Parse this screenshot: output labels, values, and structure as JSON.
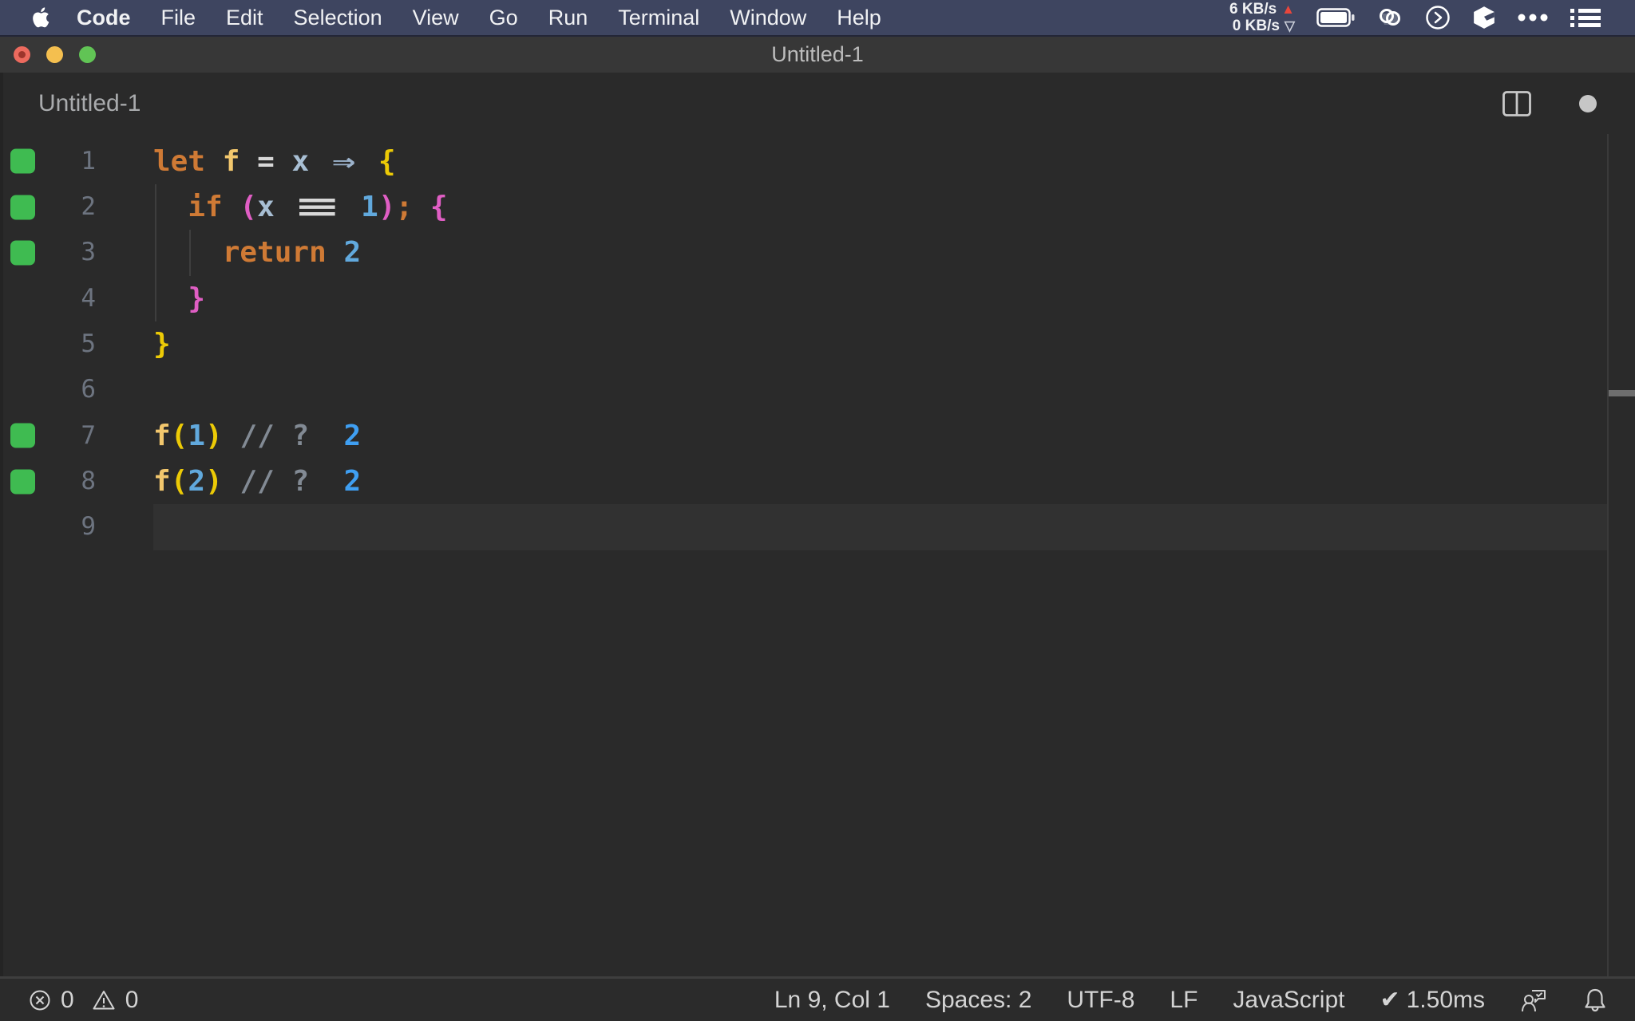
{
  "menubar": {
    "apple_icon": "apple-logo",
    "items": [
      "Code",
      "File",
      "Edit",
      "Selection",
      "View",
      "Go",
      "Run",
      "Terminal",
      "Window",
      "Help"
    ],
    "network": {
      "up": "6 KB/s",
      "down": "0 KB/s",
      "up_arrow": "▲",
      "down_arrow": "▽"
    },
    "right_icons": [
      "network-speed",
      "battery-icon",
      "linked-rings-icon",
      "terminal-circle-icon",
      "cube-icon",
      "ellipsis-icon",
      "list-icon"
    ]
  },
  "window": {
    "title": "Untitled-1",
    "traffic_lights": [
      "close",
      "minimize",
      "zoom"
    ],
    "document_edited": true
  },
  "editor": {
    "tab_title": "Untitled-1",
    "actions": [
      "split-editor-icon",
      "dirty-dot"
    ],
    "language": "javascript",
    "current_line": 9,
    "marker_lines": [
      1,
      2,
      3,
      7,
      8
    ],
    "indent_guides": [
      {
        "col": 0,
        "from": 2,
        "to": 4
      },
      {
        "col": 2,
        "from": 3,
        "to": 3
      }
    ],
    "lines": [
      [
        {
          "t": "let",
          "c": "kw"
        },
        {
          "t": " "
        },
        {
          "t": "f",
          "c": "fn"
        },
        {
          "t": " "
        },
        {
          "t": "=",
          "c": "op"
        },
        {
          "t": " "
        },
        {
          "t": "x",
          "c": "var"
        },
        {
          "t": " "
        },
        {
          "t": "⇒",
          "c": "arrow",
          "lig": 2
        },
        {
          "t": " "
        },
        {
          "t": "{",
          "c": "b1"
        }
      ],
      [
        {
          "t": "  "
        },
        {
          "t": "if",
          "c": "kw"
        },
        {
          "t": " "
        },
        {
          "t": "(",
          "c": "b2"
        },
        {
          "t": "x",
          "c": "var"
        },
        {
          "t": " "
        },
        {
          "t": "≡",
          "c": "op",
          "lig": 3
        },
        {
          "t": " "
        },
        {
          "t": "1",
          "c": "num"
        },
        {
          "t": ")",
          "c": "b2"
        },
        {
          "t": ";",
          "c": "kw"
        },
        {
          "t": " "
        },
        {
          "t": "{",
          "c": "b2"
        }
      ],
      [
        {
          "t": "    "
        },
        {
          "t": "return",
          "c": "kw"
        },
        {
          "t": " "
        },
        {
          "t": "2",
          "c": "num"
        }
      ],
      [
        {
          "t": "  "
        },
        {
          "t": "}",
          "c": "b2"
        }
      ],
      [
        {
          "t": "}",
          "c": "b1"
        }
      ],
      [],
      [
        {
          "t": "f",
          "c": "fn"
        },
        {
          "t": "(",
          "c": "b1"
        },
        {
          "t": "1",
          "c": "num"
        },
        {
          "t": ")",
          "c": "b1"
        },
        {
          "t": " "
        },
        {
          "t": "//",
          "c": "cm"
        },
        {
          "t": " "
        },
        {
          "t": "?",
          "c": "cm"
        },
        {
          "t": "  "
        },
        {
          "t": "2",
          "c": "res"
        }
      ],
      [
        {
          "t": "f",
          "c": "fn"
        },
        {
          "t": "(",
          "c": "b1"
        },
        {
          "t": "2",
          "c": "num"
        },
        {
          "t": ")",
          "c": "b1"
        },
        {
          "t": " "
        },
        {
          "t": "//",
          "c": "cm"
        },
        {
          "t": " "
        },
        {
          "t": "?",
          "c": "cm"
        },
        {
          "t": "  "
        },
        {
          "t": "2",
          "c": "res"
        }
      ],
      []
    ]
  },
  "statusbar": {
    "errors": "0",
    "warnings": "0",
    "items": [
      "Ln 9, Col 1",
      "Spaces: 2",
      "UTF-8",
      "LF",
      "JavaScript"
    ],
    "quokka": {
      "check": "✔",
      "time": "1.50ms"
    },
    "right_icons": [
      "feedback-icon",
      "bell-icon"
    ]
  },
  "colors": {
    "menubar_bg": "#3e4560",
    "titlebar_bg": "#373737",
    "editor_bg": "#2a2a2a",
    "statusbar_bg": "#2b2b2b",
    "current_line_bg": "#313131",
    "keyword": "#cf7a35",
    "function": "#f2c76d",
    "variable": "#a8bfd4",
    "operator": "#d8d8d8",
    "number": "#61a9dd",
    "result": "#3f9ff2",
    "bracket1": "#ecca06",
    "bracket2": "#e05ec4",
    "comment": "#828a94",
    "arrow": "#9cb3cc",
    "line_number": "#6d7480",
    "marker_green": "#3fbb51",
    "traffic_red": "#ec6a5e",
    "traffic_yellow": "#f4bf4f",
    "traffic_green": "#61c455",
    "net_up_red": "#e8463c"
  }
}
